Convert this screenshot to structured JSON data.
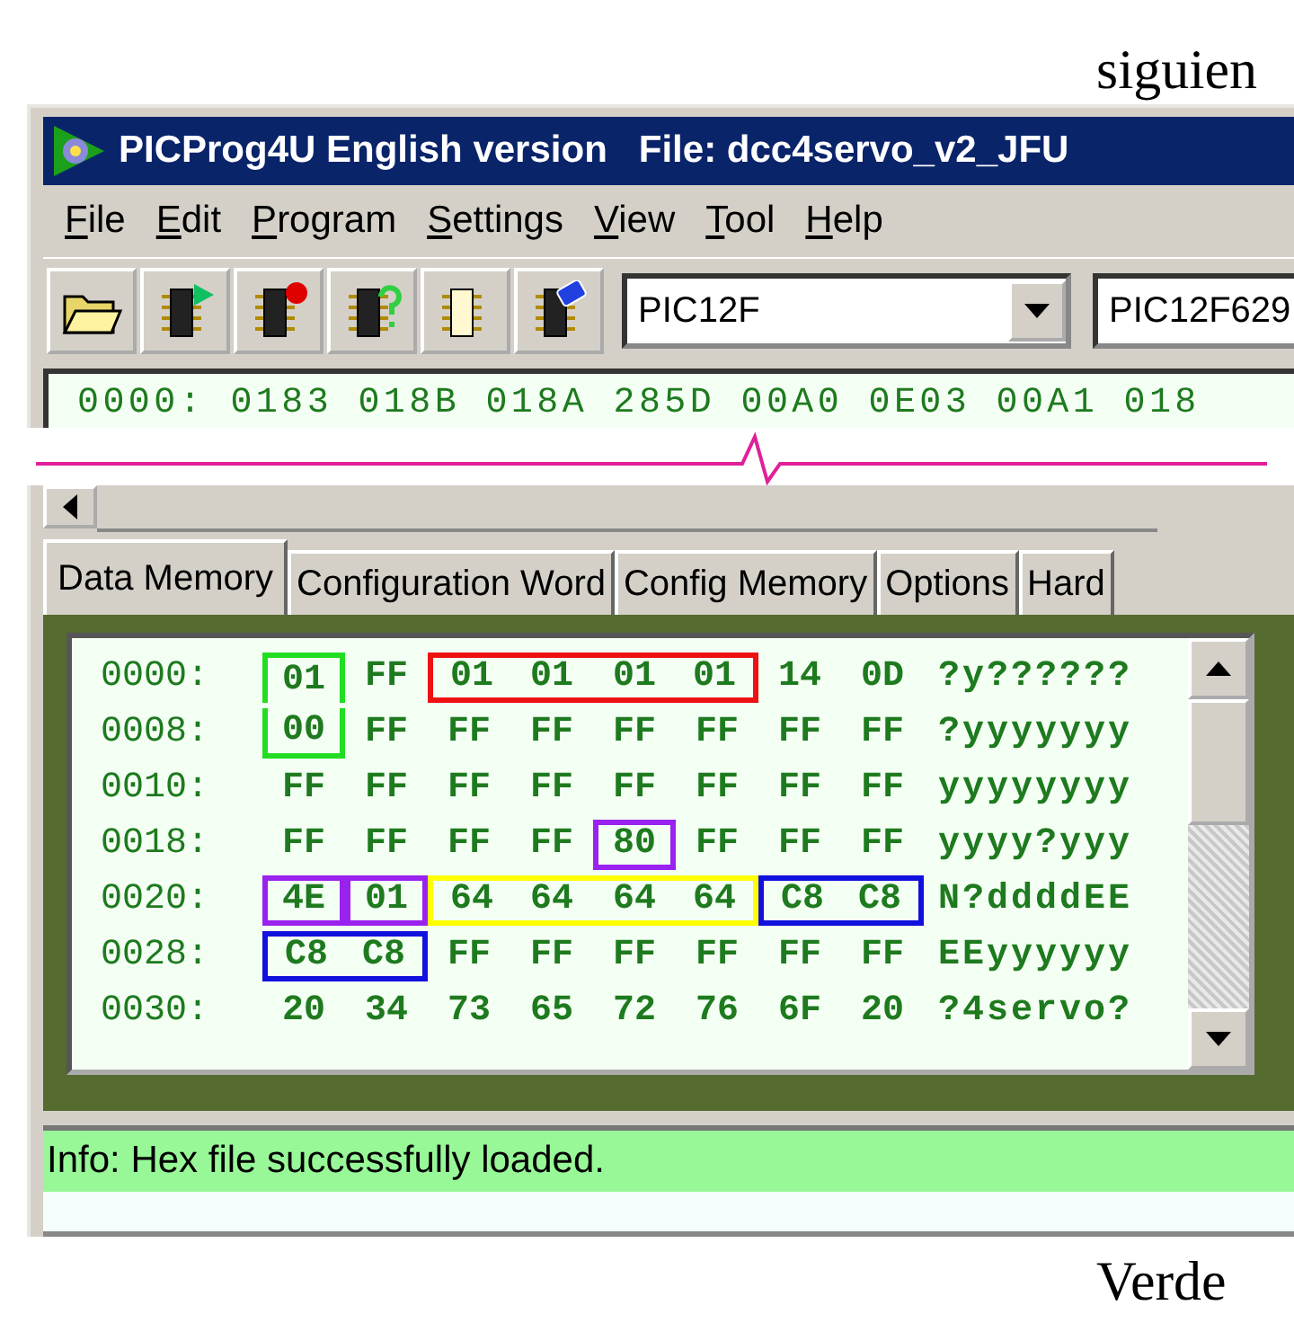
{
  "document": {
    "text_above": "siguien",
    "text_below": "Verde"
  },
  "window": {
    "title": "PICProg4U English version   File: dcc4servo_v2_JFU"
  },
  "menu": [
    "File",
    "Edit",
    "Program",
    "Settings",
    "View",
    "Tool",
    "Help"
  ],
  "toolbar": {
    "buttons": [
      {
        "kind": "open"
      },
      {
        "kind": "chip-arrow"
      },
      {
        "kind": "chip-dot"
      },
      {
        "kind": "chip-question"
      },
      {
        "kind": "chip-outline"
      },
      {
        "kind": "chip-eraser"
      }
    ],
    "family": "PIC12F",
    "device": "PIC12F629"
  },
  "program_line": "0000: 0183 018B 018A 285D 00A0 0E03 00A1 018",
  "tabs": [
    {
      "label": "Data Memory",
      "selected": true
    },
    {
      "label": "Configuration Word",
      "selected": false
    },
    {
      "label": "Config Memory",
      "selected": false
    },
    {
      "label": "Options",
      "selected": false
    },
    {
      "label": "Hard",
      "selected": false
    }
  ],
  "memory": [
    {
      "address": "0000:",
      "bytes": [
        {
          "value": "01",
          "kind": "top",
          "color": "#22dd22"
        },
        {
          "value": "FF",
          "kind": "plain"
        },
        {
          "value": "01",
          "kind": "left",
          "color": "#ee1111"
        },
        {
          "value": "01",
          "kind": "middle",
          "color": "#ee1111"
        },
        {
          "value": "01",
          "kind": "middle",
          "color": "#ee1111"
        },
        {
          "value": "01",
          "kind": "right",
          "color": "#ee1111"
        },
        {
          "value": "14",
          "kind": "plain"
        },
        {
          "value": "0D",
          "kind": "plain"
        }
      ],
      "ascii": "?y??????"
    },
    {
      "address": "0008:",
      "bytes": [
        {
          "value": "00",
          "kind": "bottom",
          "color": "#22dd22"
        },
        {
          "value": "FF",
          "kind": "plain"
        },
        {
          "value": "FF",
          "kind": "plain"
        },
        {
          "value": "FF",
          "kind": "plain"
        },
        {
          "value": "FF",
          "kind": "plain"
        },
        {
          "value": "FF",
          "kind": "plain"
        },
        {
          "value": "FF",
          "kind": "plain"
        },
        {
          "value": "FF",
          "kind": "plain"
        }
      ],
      "ascii": "?yyyyyyy"
    },
    {
      "address": "0010:",
      "bytes": [
        {
          "value": "FF",
          "kind": "plain"
        },
        {
          "value": "FF",
          "kind": "plain"
        },
        {
          "value": "FF",
          "kind": "plain"
        },
        {
          "value": "FF",
          "kind": "plain"
        },
        {
          "value": "FF",
          "kind": "plain"
        },
        {
          "value": "FF",
          "kind": "plain"
        },
        {
          "value": "FF",
          "kind": "plain"
        },
        {
          "value": "FF",
          "kind": "plain"
        }
      ],
      "ascii": "yyyyyyyy"
    },
    {
      "address": "0018:",
      "bytes": [
        {
          "value": "FF",
          "kind": "plain"
        },
        {
          "value": "FF",
          "kind": "plain"
        },
        {
          "value": "FF",
          "kind": "plain"
        },
        {
          "value": "FF",
          "kind": "plain"
        },
        {
          "value": "80",
          "kind": "single",
          "color": "#9922ee"
        },
        {
          "value": "FF",
          "kind": "plain"
        },
        {
          "value": "FF",
          "kind": "plain"
        },
        {
          "value": "FF",
          "kind": "plain"
        }
      ],
      "ascii": "yyyy?yyy"
    },
    {
      "address": "0020:",
      "bytes": [
        {
          "value": "4E",
          "kind": "single",
          "color": "#9922ee"
        },
        {
          "value": "01",
          "kind": "single",
          "color": "#9922ee"
        },
        {
          "value": "64",
          "kind": "left",
          "color": "#ffff00"
        },
        {
          "value": "64",
          "kind": "middle",
          "color": "#ffff00"
        },
        {
          "value": "64",
          "kind": "middle",
          "color": "#ffff00"
        },
        {
          "value": "64",
          "kind": "right",
          "color": "#ffff00"
        },
        {
          "value": "C8",
          "kind": "left",
          "color": "#1111dd"
        },
        {
          "value": "C8",
          "kind": "right",
          "color": "#1111dd"
        }
      ],
      "ascii": "N?ddddEE"
    },
    {
      "address": "0028:",
      "bytes": [
        {
          "value": "C8",
          "kind": "left",
          "color": "#1111dd"
        },
        {
          "value": "C8",
          "kind": "right",
          "color": "#1111dd"
        },
        {
          "value": "FF",
          "kind": "plain"
        },
        {
          "value": "FF",
          "kind": "plain"
        },
        {
          "value": "FF",
          "kind": "plain"
        },
        {
          "value": "FF",
          "kind": "plain"
        },
        {
          "value": "FF",
          "kind": "plain"
        },
        {
          "value": "FF",
          "kind": "plain"
        }
      ],
      "ascii": "EEyyyyyy"
    },
    {
      "address": "0030:",
      "bytes": [
        {
          "value": "20",
          "kind": "plain"
        },
        {
          "value": "34",
          "kind": "plain"
        },
        {
          "value": "73",
          "kind": "plain"
        },
        {
          "value": "65",
          "kind": "plain"
        },
        {
          "value": "72",
          "kind": "plain"
        },
        {
          "value": "76",
          "kind": "plain"
        },
        {
          "value": "6F",
          "kind": "plain"
        },
        {
          "value": "20",
          "kind": "plain"
        }
      ],
      "ascii": "?4servo?"
    }
  ],
  "status": "Info: Hex file successfully loaded."
}
